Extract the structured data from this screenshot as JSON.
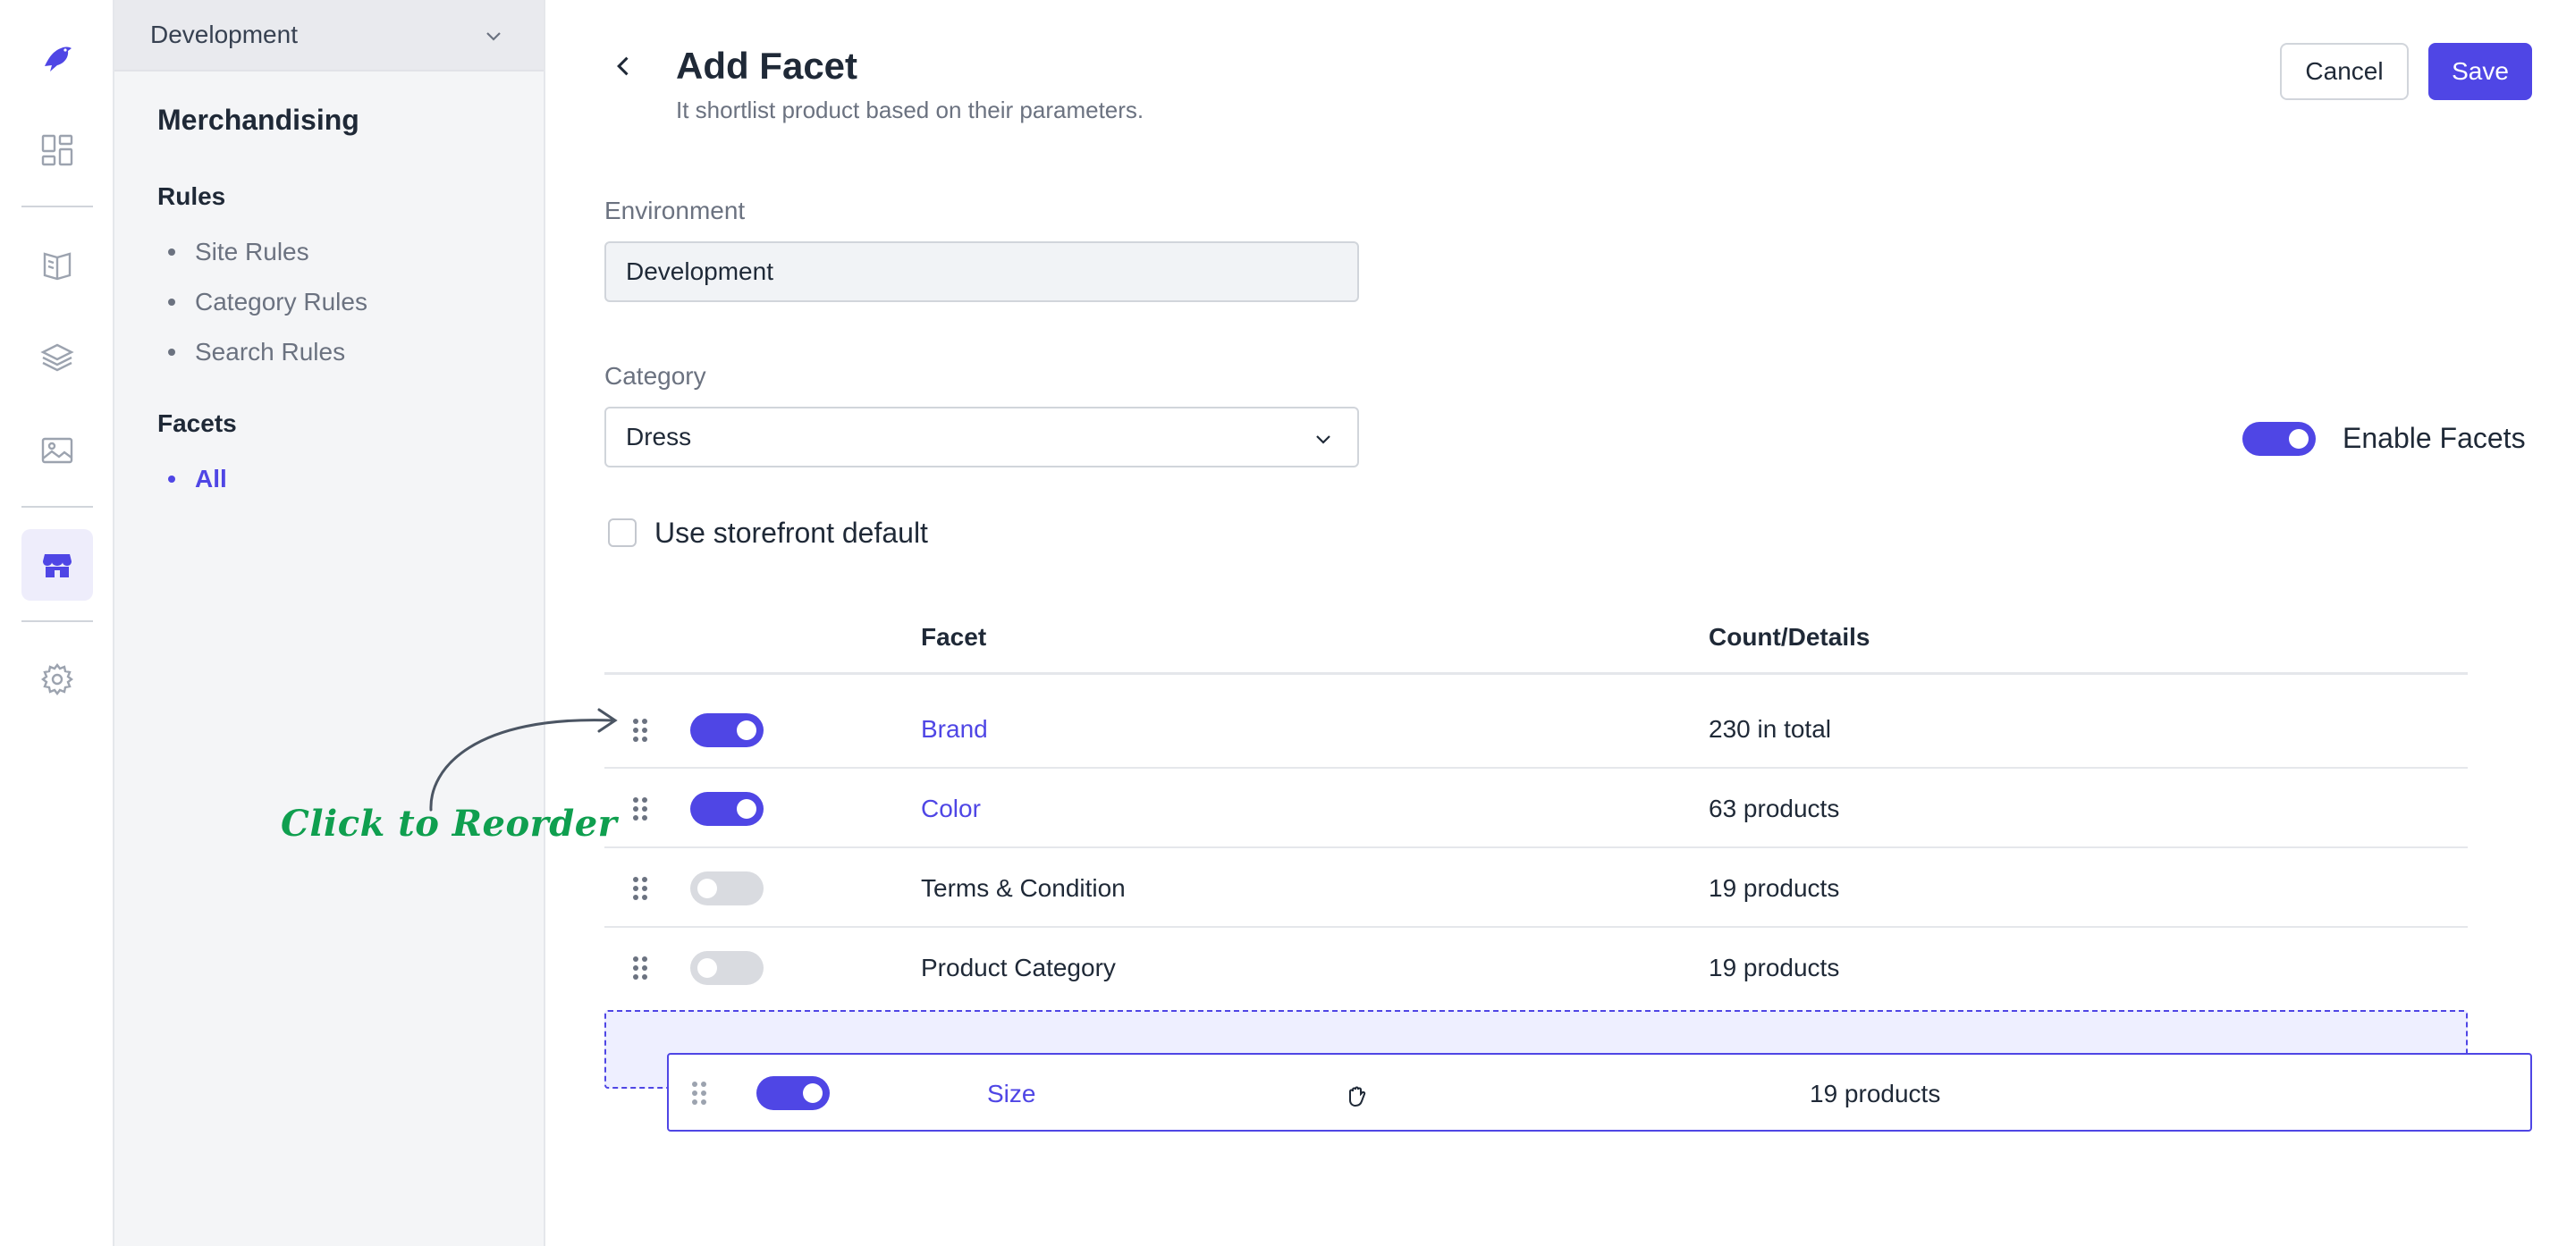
{
  "rail": {
    "items": [
      {
        "name": "logo",
        "icon": "bird-logo-icon"
      },
      {
        "name": "dashboard",
        "icon": "dashboard-icon"
      },
      {
        "name": "catalog",
        "icon": "book-icon"
      },
      {
        "name": "layers",
        "icon": "layers-icon"
      },
      {
        "name": "media",
        "icon": "image-icon"
      },
      {
        "name": "storefront",
        "icon": "store-icon",
        "active": true
      },
      {
        "name": "settings",
        "icon": "gear-icon"
      }
    ]
  },
  "subnav": {
    "environment": "Development",
    "title": "Merchandising",
    "groups": [
      {
        "title": "Rules",
        "items": [
          {
            "label": "Site Rules"
          },
          {
            "label": "Category Rules"
          },
          {
            "label": "Search Rules"
          }
        ]
      },
      {
        "title": "Facets",
        "items": [
          {
            "label": "All",
            "active": true
          }
        ]
      }
    ]
  },
  "header": {
    "title": "Add Facet",
    "subtitle": "It shortlist product based on their parameters.",
    "cancel_label": "Cancel",
    "save_label": "Save"
  },
  "form": {
    "environment_label": "Environment",
    "environment_value": "Development",
    "category_label": "Category",
    "category_value": "Dress",
    "storefront_default_label": "Use storefront default",
    "storefront_default_checked": false,
    "enable_facets_label": "Enable Facets",
    "enable_facets_on": true
  },
  "table": {
    "columns": [
      "Facet",
      "Count/Details"
    ],
    "rows": [
      {
        "facet": "Brand",
        "count": "230 in total",
        "enabled": true
      },
      {
        "facet": "Color",
        "count": "63 products",
        "enabled": true
      },
      {
        "facet": "Terms & Condition",
        "count": "19 products",
        "enabled": false
      },
      {
        "facet": "Product Category",
        "count": "19 products",
        "enabled": false
      }
    ],
    "dragging_row": {
      "facet": "Size",
      "count": "19 products",
      "enabled": true
    }
  },
  "annotation": {
    "text": "Click to Reorder"
  },
  "colors": {
    "accent": "#4f46e5",
    "annotation": "#0f9f4f"
  }
}
